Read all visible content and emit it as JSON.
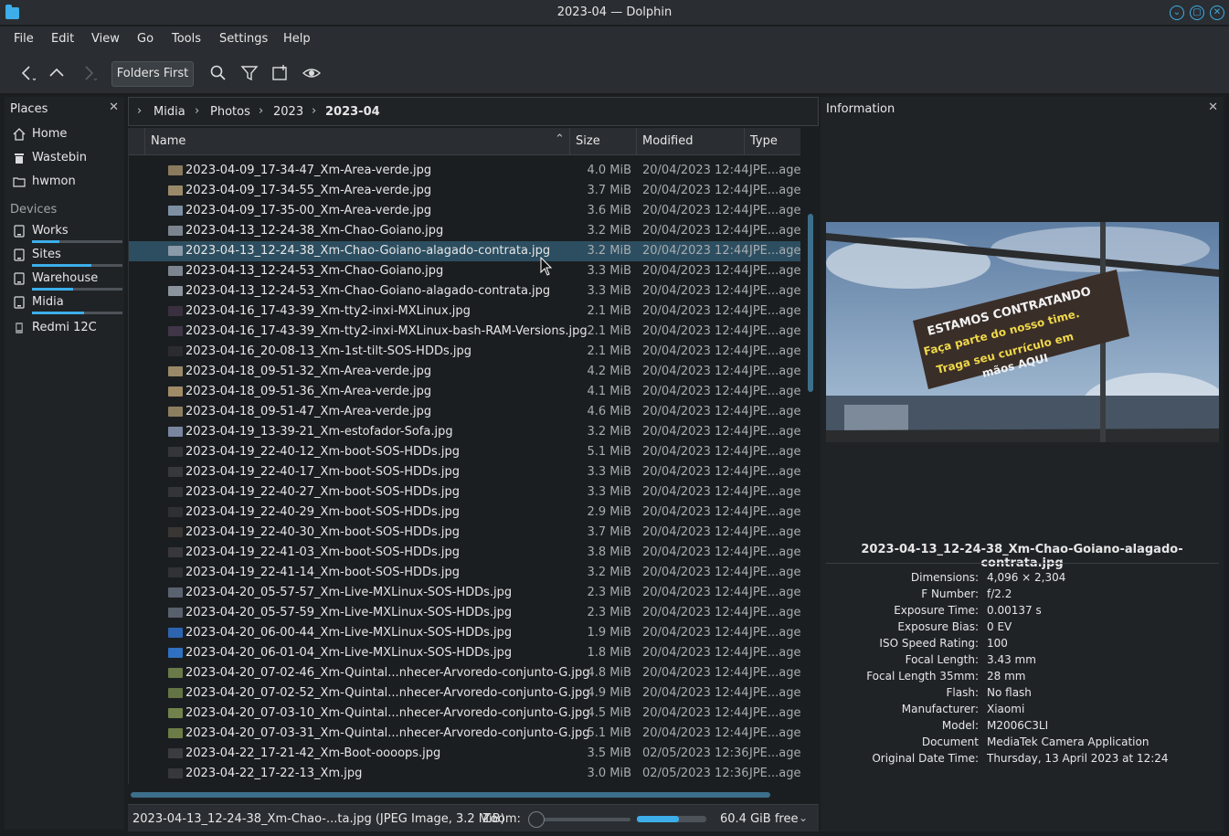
{
  "window": {
    "title": "2023-04 — Dolphin"
  },
  "menu": [
    "File",
    "Edit",
    "View",
    "Go",
    "Tools",
    "Settings",
    "Help"
  ],
  "toolbar": {
    "folders_first_label": "Folders First"
  },
  "places": {
    "header": "Places",
    "items": [
      {
        "label": "Home",
        "icon": "home-icon"
      },
      {
        "label": "Wastebin",
        "icon": "trash-icon"
      },
      {
        "label": "hwmon",
        "icon": "folder-icon"
      }
    ],
    "devices_header": "Devices",
    "devices": [
      {
        "label": "Works",
        "usage": 0.3
      },
      {
        "label": "Sites",
        "usage": 0.66
      },
      {
        "label": "Warehouse",
        "usage": 0.45
      },
      {
        "label": "Midia",
        "usage": 0.58
      },
      {
        "label": "Redmi 12C",
        "usage": null
      }
    ]
  },
  "breadcrumb": [
    "Midia",
    "Photos",
    "2023",
    "2023-04"
  ],
  "columns": {
    "name": "Name",
    "size": "Size",
    "modified": "Modified",
    "type": "Type"
  },
  "files": [
    {
      "name": "2023-04-09_17-34-47_Xm-Area-verde.jpg",
      "size": "4.0 MiB",
      "modified": "20/04/2023 12:44",
      "type": "JPE...age",
      "thumb": "#8a7a5e"
    },
    {
      "name": "2023-04-09_17-34-55_Xm-Area-verde.jpg",
      "size": "3.7 MiB",
      "modified": "20/04/2023 12:44",
      "type": "JPE...age",
      "thumb": "#9a8a6a"
    },
    {
      "name": "2023-04-09_17-35-00_Xm-Area-verde.jpg",
      "size": "3.6 MiB",
      "modified": "20/04/2023 12:44",
      "type": "JPE...age",
      "thumb": "#7e8fa4"
    },
    {
      "name": "2023-04-13_12-24-38_Xm-Chao-Goiano.jpg",
      "size": "3.2 MiB",
      "modified": "20/04/2023 12:44",
      "type": "JPE...age",
      "thumb": "#7c8490"
    },
    {
      "name": "2023-04-13_12-24-38_Xm-Chao-Goiano-alagado-contrata.jpg",
      "size": "3.2 MiB",
      "modified": "20/04/2023 12:44",
      "type": "JPE...age",
      "thumb": "#8a9aa8",
      "selected": true
    },
    {
      "name": "2023-04-13_12-24-53_Xm-Chao-Goiano.jpg",
      "size": "3.3 MiB",
      "modified": "20/04/2023 12:44",
      "type": "JPE...age",
      "thumb": "#7d8590"
    },
    {
      "name": "2023-04-13_12-24-53_Xm-Chao-Goiano-alagado-contrata.jpg",
      "size": "3.3 MiB",
      "modified": "20/04/2023 12:44",
      "type": "JPE...age",
      "thumb": "#8b939c"
    },
    {
      "name": "2023-04-16_17-43-39_Xm-tty2-inxi-MXLinux.jpg",
      "size": "2.1 MiB",
      "modified": "20/04/2023 12:44",
      "type": "JPE...age",
      "thumb": "#3a3040"
    },
    {
      "name": "2023-04-16_17-43-39_Xm-tty2-inxi-MXLinux-bash-RAM-Versions.jpg",
      "size": "2.1 MiB",
      "modified": "20/04/2023 12:44",
      "type": "JPE...age",
      "thumb": "#403648"
    },
    {
      "name": "2023-04-16_20-08-13_Xm-1st-tilt-SOS-HDDs.jpg",
      "size": "2.1 MiB",
      "modified": "20/04/2023 12:44",
      "type": "JPE...age",
      "thumb": "#2c2c30"
    },
    {
      "name": "2023-04-18_09-51-32_Xm-Area-verde.jpg",
      "size": "4.2 MiB",
      "modified": "20/04/2023 12:44",
      "type": "JPE...age",
      "thumb": "#9a8868"
    },
    {
      "name": "2023-04-18_09-51-36_Xm-Area-verde.jpg",
      "size": "4.1 MiB",
      "modified": "20/04/2023 12:44",
      "type": "JPE...age",
      "thumb": "#a08c66"
    },
    {
      "name": "2023-04-18_09-51-47_Xm-Area-verde.jpg",
      "size": "4.6 MiB",
      "modified": "20/04/2023 12:44",
      "type": "JPE...age",
      "thumb": "#8e7e60"
    },
    {
      "name": "2023-04-19_13-39-21_Xm-estofador-Sofa.jpg",
      "size": "3.2 MiB",
      "modified": "20/04/2023 12:44",
      "type": "JPE...age",
      "thumb": "#7a86a0"
    },
    {
      "name": "2023-04-19_22-40-12_Xm-boot-SOS-HDDs.jpg",
      "size": "5.1 MiB",
      "modified": "20/04/2023 12:44",
      "type": "JPE...age",
      "thumb": "#34363a"
    },
    {
      "name": "2023-04-19_22-40-17_Xm-boot-SOS-HDDs.jpg",
      "size": "3.3 MiB",
      "modified": "20/04/2023 12:44",
      "type": "JPE...age",
      "thumb": "#36383c"
    },
    {
      "name": "2023-04-19_22-40-27_Xm-boot-SOS-HDDs.jpg",
      "size": "3.3 MiB",
      "modified": "20/04/2023 12:44",
      "type": "JPE...age",
      "thumb": "#333538"
    },
    {
      "name": "2023-04-19_22-40-29_Xm-boot-SOS-HDDs.jpg",
      "size": "2.9 MiB",
      "modified": "20/04/2023 12:44",
      "type": "JPE...age",
      "thumb": "#2e3034"
    },
    {
      "name": "2023-04-19_22-40-30_Xm-boot-SOS-HDDs.jpg",
      "size": "3.7 MiB",
      "modified": "20/04/2023 12:44",
      "type": "JPE...age",
      "thumb": "#3a3634"
    },
    {
      "name": "2023-04-19_22-41-03_Xm-boot-SOS-HDDs.jpg",
      "size": "3.8 MiB",
      "modified": "20/04/2023 12:44",
      "type": "JPE...age",
      "thumb": "#38383a"
    },
    {
      "name": "2023-04-19_22-41-14_Xm-boot-SOS-HDDs.jpg",
      "size": "3.2 MiB",
      "modified": "20/04/2023 12:44",
      "type": "JPE...age",
      "thumb": "#303236"
    },
    {
      "name": "2023-04-20_05-57-57_Xm-Live-MXLinux-SOS-HDDs.jpg",
      "size": "2.3 MiB",
      "modified": "20/04/2023 12:44",
      "type": "JPE...age",
      "thumb": "#5a6270"
    },
    {
      "name": "2023-04-20_05-57-59_Xm-Live-MXLinux-SOS-HDDs.jpg",
      "size": "2.3 MiB",
      "modified": "20/04/2023 12:44",
      "type": "JPE...age",
      "thumb": "#58606c"
    },
    {
      "name": "2023-04-20_06-00-44_Xm-Live-MXLinux-SOS-HDDs.jpg",
      "size": "1.9 MiB",
      "modified": "20/04/2023 12:44",
      "type": "JPE...age",
      "thumb": "#2d64b0"
    },
    {
      "name": "2023-04-20_06-01-04_Xm-Live-MXLinux-SOS-HDDs.jpg",
      "size": "1.8 MiB",
      "modified": "20/04/2023 12:44",
      "type": "JPE...age",
      "thumb": "#3070c0"
    },
    {
      "name": "2023-04-20_07-02-46_Xm-Quintal...nhecer-Arvoredo-conjunto-G.jpg",
      "size": "4.8 MiB",
      "modified": "20/04/2023 12:44",
      "type": "JPE...age",
      "thumb": "#6a7a48"
    },
    {
      "name": "2023-04-20_07-02-52_Xm-Quintal...nhecer-Arvoredo-conjunto-G.jpg",
      "size": "4.9 MiB",
      "modified": "20/04/2023 12:44",
      "type": "JPE...age",
      "thumb": "#647444"
    },
    {
      "name": "2023-04-20_07-03-10_Xm-Quintal...nhecer-Arvoredo-conjunto-G.jpg",
      "size": "4.5 MiB",
      "modified": "20/04/2023 12:44",
      "type": "JPE...age",
      "thumb": "#72824c"
    },
    {
      "name": "2023-04-20_07-03-31_Xm-Quintal...nhecer-Arvoredo-conjunto-G.jpg",
      "size": "5.1 MiB",
      "modified": "20/04/2023 12:44",
      "type": "JPE...age",
      "thumb": "#6c7c46"
    },
    {
      "name": "2023-04-22_17-21-42_Xm-Boot-oooops.jpg",
      "size": "3.5 MiB",
      "modified": "02/05/2023 12:36",
      "type": "JPE...age",
      "thumb": "#3a3c40"
    },
    {
      "name": "2023-04-22_17-22-13_Xm.jpg",
      "size": "3.0 MiB",
      "modified": "02/05/2023 12:36",
      "type": "JPE...age",
      "thumb": "#36383c"
    }
  ],
  "status": {
    "text": "2023-04-13_12-24-38_Xm-Chao-...ta.jpg (JPEG Image, 3.2 MiB)",
    "zoom_label": "Zoom:",
    "zoom_level": 0.0,
    "free_space": "60.4 GiB free",
    "disk_usage": 0.6
  },
  "info": {
    "header": "Information",
    "preview_text": [
      "ESTAMOS CONTRATANDO",
      "Faça parte do nosso time.",
      "Traga seu currículo em",
      "mãos AQUI"
    ],
    "filename": "2023-04-13_12-24-38_Xm-Chao-Goiano-alagado-contrata.jpg",
    "meta": [
      {
        "key": "Dimensions:",
        "value": "4,096 × 2,304"
      },
      {
        "key": "F Number:",
        "value": "f/2.2"
      },
      {
        "key": "Exposure Time:",
        "value": "0.00137 s"
      },
      {
        "key": "Exposure Bias:",
        "value": "0 EV"
      },
      {
        "key": "ISO Speed Rating:",
        "value": "100"
      },
      {
        "key": "Focal Length:",
        "value": "3.43 mm"
      },
      {
        "key": "Focal Length 35mm:",
        "value": "28 mm"
      },
      {
        "key": "Flash:",
        "value": "No flash"
      },
      {
        "key": "Manufacturer:",
        "value": "Xiaomi"
      },
      {
        "key": "Model:",
        "value": "M2006C3LI"
      },
      {
        "key": "Document",
        "value": "MediaTek Camera Application"
      },
      {
        "key": "Original Date Time:",
        "value": "Thursday, 13 April 2023 at 12:24"
      }
    ]
  },
  "colors": {
    "accent": "#3daee9",
    "selection": "#2c4e60",
    "background": "#1b1e20",
    "panel": "#202326"
  }
}
